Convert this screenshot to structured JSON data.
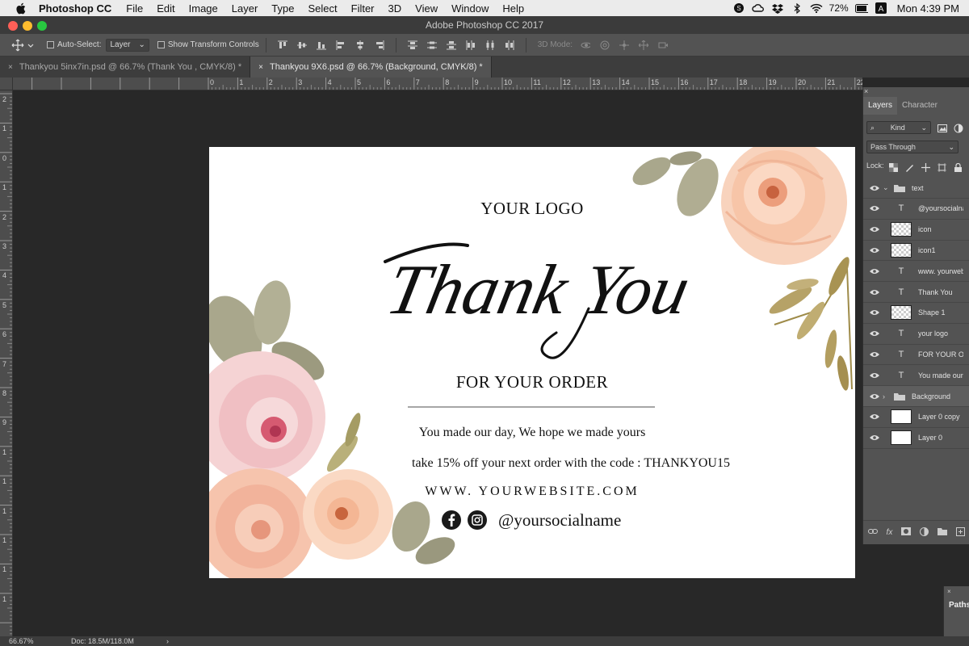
{
  "menubar": {
    "app_name": "Photoshop CC",
    "items": [
      "File",
      "Edit",
      "Image",
      "Layer",
      "Type",
      "Select",
      "Filter",
      "3D",
      "View",
      "Window",
      "Help"
    ],
    "battery": "72%",
    "clock": "Mon 4:39 PM",
    "icons": [
      "apple-icon",
      "skype-icon",
      "creative-cloud-icon",
      "dropbox-icon",
      "bluetooth-icon",
      "wifi-icon",
      "battery-icon",
      "input-source-icon"
    ]
  },
  "window": {
    "title": "Adobe Photoshop CC 2017"
  },
  "options": {
    "auto_select_label": "Auto-Select:",
    "auto_select_value": "Layer",
    "transform_label": "Show Transform Controls",
    "mode3d_label": "3D Mode:"
  },
  "tabs": [
    {
      "label": "Thankyou 5inx7in.psd @ 66.7% (Thank You , CMYK/8) *",
      "close": "×"
    },
    {
      "label": "Thankyou 9X6.psd @ 66.7% (Background, CMYK/8) *",
      "close": "×"
    }
  ],
  "ruler": {
    "h": [
      "0",
      "1",
      "2",
      "3",
      "4",
      "5",
      "6",
      "7",
      "8",
      "9",
      "10",
      "11",
      "12",
      "13",
      "14",
      "15",
      "16",
      "17",
      "18",
      "19",
      "20",
      "21",
      "22"
    ],
    "v": [
      "2",
      "1",
      "0",
      "1",
      "2",
      "3",
      "4",
      "5",
      "6",
      "7",
      "8",
      "9",
      "1",
      "1",
      "1",
      "1",
      "1",
      "1"
    ]
  },
  "artboard": {
    "logo": "YOUR LOGO",
    "thanks": "Thank You",
    "order": "FOR YOUR ORDER",
    "made_day": "You made our day, We hope we made yours",
    "promo": "take 15% off your next order with the code : THANKYOU15",
    "website": "WWW. YOURWEBSITE.COM",
    "social": "@yoursocialname",
    "social_icons": [
      "facebook-icon",
      "instagram-icon"
    ]
  },
  "status": {
    "zoom": "66.67%",
    "doc": "Doc: 18.5M/118.0M",
    "arrow": "›"
  },
  "panel": {
    "close": "×",
    "tabs": [
      "Layers",
      "Character"
    ],
    "kind": "Kind",
    "blend": "Pass Through",
    "lock_label": "Lock:",
    "layers": [
      {
        "name": "text",
        "kind": "group",
        "expanded": "⌄"
      },
      {
        "name": "@yoursocialname",
        "kind": "type"
      },
      {
        "name": "icon",
        "kind": "pixel"
      },
      {
        "name": "icon1",
        "kind": "pixel"
      },
      {
        "name": "www. yourwebsite",
        "kind": "type"
      },
      {
        "name": "Thank You",
        "kind": "type"
      },
      {
        "name": "Shape 1",
        "kind": "shape"
      },
      {
        "name": "your logo",
        "kind": "type"
      },
      {
        "name": "FOR YOUR ORDER",
        "kind": "type"
      },
      {
        "name": "You made our day",
        "kind": "type"
      },
      {
        "name": "Background",
        "kind": "group",
        "expanded": "›"
      },
      {
        "name": "Layer 0 copy",
        "kind": "white"
      },
      {
        "name": "Layer 0",
        "kind": "white"
      }
    ],
    "type_glyph": "T",
    "footer": [
      "link-icon",
      "fx",
      "mask-icon",
      "adjustment-icon",
      "group-icon",
      "new-layer-icon",
      "trash-icon"
    ],
    "fx_label": "fx"
  },
  "paths": {
    "label": "Paths",
    "close": "×"
  },
  "colors": {
    "menubar_bg": "#ebebeb",
    "ui_dark": "#535353",
    "pasteboard": "#282828",
    "leaf": "#a7a48a",
    "rose_pink": "#f3c6c8",
    "rose_peach": "#f7c7ad"
  }
}
